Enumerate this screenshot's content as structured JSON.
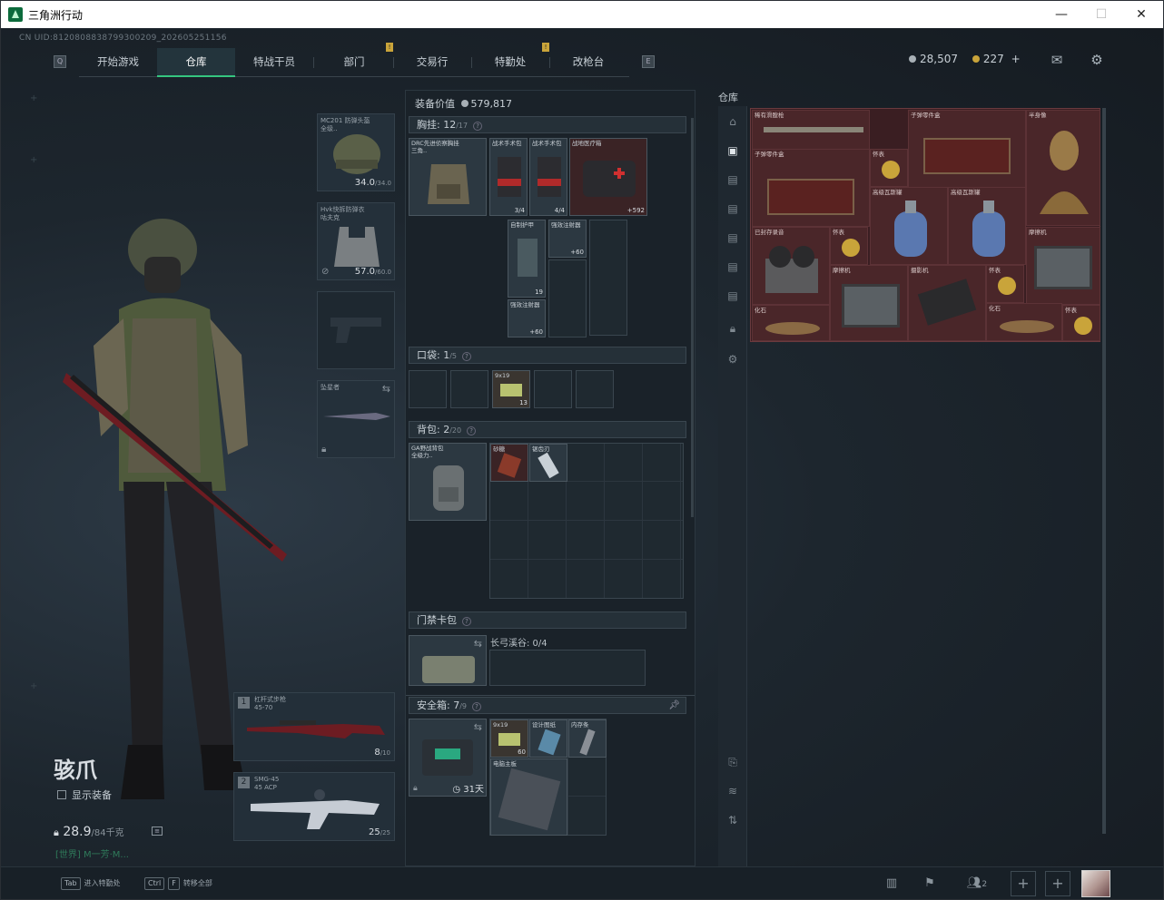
{
  "window": {
    "title": "三角洲行动",
    "controls": [
      "—",
      "☐",
      "✕"
    ]
  },
  "uid": "CN UID:8120808838799300209_202605251156",
  "nav": {
    "left_key": "Q",
    "right_key": "E",
    "tabs": [
      {
        "label": "开始游戏"
      },
      {
        "label": "仓库",
        "active": true
      },
      {
        "label": "特战干员"
      },
      {
        "label": "部门"
      },
      {
        "label": "交易行"
      },
      {
        "label": "特勤处"
      },
      {
        "label": "改枪台"
      }
    ],
    "notif_mark": "!"
  },
  "currency": {
    "silver": "28,507",
    "gold": "227",
    "add": "+"
  },
  "equipment": {
    "helmet": {
      "name": "MC201 防弹头盔",
      "name2": "全级..",
      "dur": "34.0",
      "max": "/34.0"
    },
    "armor": {
      "name": "Hvk快拆防弹衣",
      "name2": "咕夫克",
      "dur": "57.0",
      "max": "/60.0"
    },
    "melee": {
      "name": "坠星者"
    }
  },
  "character": {
    "name": "骇爪",
    "show_equipment": "显示装备",
    "weight": "28.9",
    "weight_max": "/84千克",
    "world": "[世界] M一芳·M..."
  },
  "weapons": [
    {
      "idx": "1",
      "name": "杠杆式步枪",
      "ammo_type": "45-70",
      "count": "8",
      "max": "/10"
    },
    {
      "idx": "2",
      "name": "SMG-45",
      "ammo_type": "45 ACP",
      "count": "25",
      "max": "/25"
    }
  ],
  "loadout": {
    "value_label": "装备价值",
    "value": "579,817",
    "chest": {
      "title": "胸挂:",
      "count": "12",
      "max": "/17",
      "help": "?"
    },
    "chest_items": {
      "rig": "DRC先进侦察胸挂",
      "rig2": "三角..",
      "kit1": "战术手术包",
      "kit1c": "3/4",
      "kit2": "战术手术包",
      "kit2c": "4/4",
      "medkit": "战地医疗箱",
      "medkitc": "+592",
      "plate": "自制护甲",
      "platec": "19",
      "inj1": "强效注射器",
      "inj1c": "+60",
      "inj2": "强效注射器",
      "inj2c": "+60"
    },
    "pocket": {
      "title": "口袋:",
      "count": "1",
      "max": "/5",
      "help": "?",
      "ammo": "9x19",
      "ammoc": "13"
    },
    "backpack": {
      "title": "背包:",
      "count": "2",
      "max": "/20",
      "help": "?",
      "bag": "GA野战背包",
      "bag2": "全级力..",
      "item1": "砂糖",
      "item2": "锯齿刃"
    },
    "keycard": {
      "title": "门禁卡包",
      "help": "?",
      "slot": "长弓溪谷: 0/4"
    },
    "safebox": {
      "title": "安全箱:",
      "count": "7",
      "max": "/9",
      "help": "?",
      "days": "31天",
      "ammo": "9x19",
      "ammoc": "60",
      "blueprint": "设计图纸",
      "ram": "内存条",
      "board": "电脑主板"
    }
  },
  "warehouse": {
    "title": "仓库",
    "items": [
      {
        "name": "稀有滑膛枪"
      },
      {
        "name": "子弹零件盒"
      },
      {
        "name": "半身像"
      },
      {
        "name": "子弹零件盒"
      },
      {
        "name": "怀表"
      },
      {
        "name": "高级瓦斯罐"
      },
      {
        "name": "高级瓦斯罐"
      },
      {
        "name": "已封存录音"
      },
      {
        "name": "怀表"
      },
      {
        "name": "摩擦机"
      },
      {
        "name": "摩擦机"
      },
      {
        "name": "摄影机"
      },
      {
        "name": "怀表"
      },
      {
        "name": "化石"
      },
      {
        "name": "化石"
      },
      {
        "name": "怀表"
      }
    ]
  },
  "bottom": {
    "hint1_key": "Tab",
    "hint1": "进入特勤处",
    "hint2_key1": "Ctrl",
    "hint2_key2": "F",
    "hint2": "转移全部",
    "team_count": "2"
  },
  "colors": {
    "accent": "#35c57f",
    "warehouse_bg": "#3a1e22",
    "gold_item": "#c9a43a"
  }
}
